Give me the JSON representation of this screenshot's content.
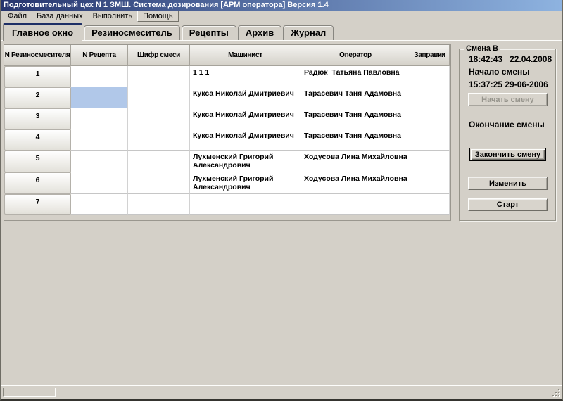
{
  "window": {
    "title": "Подготовительный цех N 1 ЗМШ. Система дозирования [АРМ оператора] Версия 1.4"
  },
  "menu": {
    "items": [
      "Файл",
      "База данных",
      "Выполнить",
      "Помощь"
    ]
  },
  "tabs": {
    "items": [
      "Главное окно",
      "Резиносмеситель",
      "Рецепты",
      "Архив",
      "Журнал"
    ],
    "active": "Главное окно"
  },
  "grid": {
    "columns": [
      "N Резиносмесителя",
      "N Рецепта",
      "Шифр смеси",
      "Машинист",
      "Оператор",
      "Заправки"
    ],
    "rows": [
      {
        "mixer": "1",
        "recipe": "",
        "mix_code": "",
        "machinist": "1 1 1",
        "operator": "Радюк  Татьяна Павловна",
        "fills": ""
      },
      {
        "mixer": "2",
        "recipe": "",
        "mix_code": "",
        "machinist": "Кукса Николай Дмитриевич",
        "operator": "Тарасевич Таня Адамовна",
        "fills": ""
      },
      {
        "mixer": "3",
        "recipe": "",
        "mix_code": "",
        "machinist": "Кукса Николай Дмитриевич",
        "operator": "Тарасевич Таня Адамовна",
        "fills": ""
      },
      {
        "mixer": "4",
        "recipe": "",
        "mix_code": "",
        "machinist": "Кукса Николай Дмитриевич",
        "operator": "Тарасевич Таня Адамовна",
        "fills": ""
      },
      {
        "mixer": "5",
        "recipe": "",
        "mix_code": "",
        "machinist": "Лухменский Григорий Александрович",
        "operator": "Ходусова Лина Михайловна",
        "fills": ""
      },
      {
        "mixer": "6",
        "recipe": "",
        "mix_code": "",
        "machinist": "Лухменский Григорий Александрович",
        "operator": "Ходусова Лина Михайловна",
        "fills": ""
      },
      {
        "mixer": "7",
        "recipe": "",
        "mix_code": "",
        "machinist": "",
        "operator": "",
        "fills": ""
      }
    ],
    "selection": {
      "row": 2,
      "column": "N Рецепта"
    }
  },
  "shift_panel": {
    "title": "Смена В",
    "time": "18:42:43",
    "date": "22.04.2008",
    "start_label": "Начало смены",
    "start_value": "15:37:25 29-06-2006",
    "btn_begin": "Начать смену",
    "end_label": "Окончание смены",
    "btn_end": "Закончить смену",
    "btn_edit": "Изменить",
    "btn_start": "Старт"
  },
  "colors": {
    "window_bg": "#d4d0c8",
    "titlebar_left": "#26356e",
    "titlebar_right": "#8eb3e0",
    "active_tab_accent": "#1e2f66",
    "selected_cell": "#b1c8e9",
    "disabled_text": "#96948c"
  }
}
